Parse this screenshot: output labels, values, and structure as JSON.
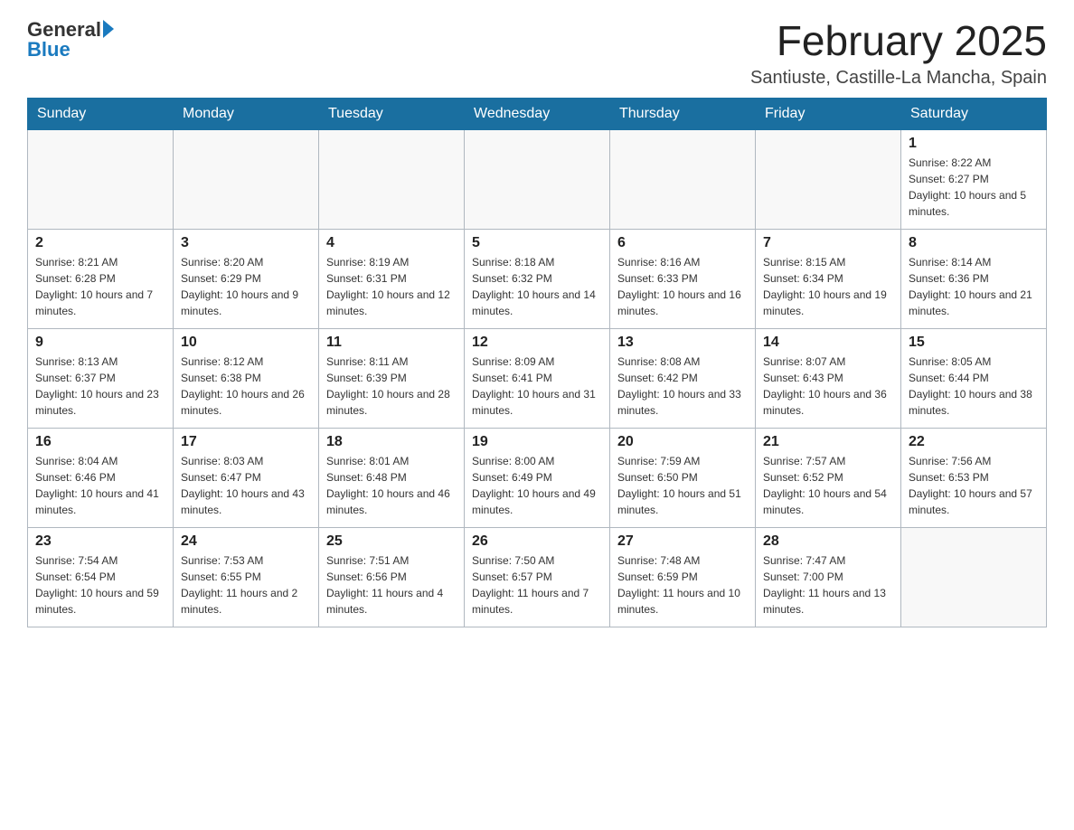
{
  "header": {
    "logo_general": "General",
    "logo_blue": "Blue",
    "month_title": "February 2025",
    "location": "Santiuste, Castille-La Mancha, Spain"
  },
  "weekdays": [
    "Sunday",
    "Monday",
    "Tuesday",
    "Wednesday",
    "Thursday",
    "Friday",
    "Saturday"
  ],
  "weeks": [
    [
      {
        "day": "",
        "info": ""
      },
      {
        "day": "",
        "info": ""
      },
      {
        "day": "",
        "info": ""
      },
      {
        "day": "",
        "info": ""
      },
      {
        "day": "",
        "info": ""
      },
      {
        "day": "",
        "info": ""
      },
      {
        "day": "1",
        "info": "Sunrise: 8:22 AM\nSunset: 6:27 PM\nDaylight: 10 hours and 5 minutes."
      }
    ],
    [
      {
        "day": "2",
        "info": "Sunrise: 8:21 AM\nSunset: 6:28 PM\nDaylight: 10 hours and 7 minutes."
      },
      {
        "day": "3",
        "info": "Sunrise: 8:20 AM\nSunset: 6:29 PM\nDaylight: 10 hours and 9 minutes."
      },
      {
        "day": "4",
        "info": "Sunrise: 8:19 AM\nSunset: 6:31 PM\nDaylight: 10 hours and 12 minutes."
      },
      {
        "day": "5",
        "info": "Sunrise: 8:18 AM\nSunset: 6:32 PM\nDaylight: 10 hours and 14 minutes."
      },
      {
        "day": "6",
        "info": "Sunrise: 8:16 AM\nSunset: 6:33 PM\nDaylight: 10 hours and 16 minutes."
      },
      {
        "day": "7",
        "info": "Sunrise: 8:15 AM\nSunset: 6:34 PM\nDaylight: 10 hours and 19 minutes."
      },
      {
        "day": "8",
        "info": "Sunrise: 8:14 AM\nSunset: 6:36 PM\nDaylight: 10 hours and 21 minutes."
      }
    ],
    [
      {
        "day": "9",
        "info": "Sunrise: 8:13 AM\nSunset: 6:37 PM\nDaylight: 10 hours and 23 minutes."
      },
      {
        "day": "10",
        "info": "Sunrise: 8:12 AM\nSunset: 6:38 PM\nDaylight: 10 hours and 26 minutes."
      },
      {
        "day": "11",
        "info": "Sunrise: 8:11 AM\nSunset: 6:39 PM\nDaylight: 10 hours and 28 minutes."
      },
      {
        "day": "12",
        "info": "Sunrise: 8:09 AM\nSunset: 6:41 PM\nDaylight: 10 hours and 31 minutes."
      },
      {
        "day": "13",
        "info": "Sunrise: 8:08 AM\nSunset: 6:42 PM\nDaylight: 10 hours and 33 minutes."
      },
      {
        "day": "14",
        "info": "Sunrise: 8:07 AM\nSunset: 6:43 PM\nDaylight: 10 hours and 36 minutes."
      },
      {
        "day": "15",
        "info": "Sunrise: 8:05 AM\nSunset: 6:44 PM\nDaylight: 10 hours and 38 minutes."
      }
    ],
    [
      {
        "day": "16",
        "info": "Sunrise: 8:04 AM\nSunset: 6:46 PM\nDaylight: 10 hours and 41 minutes."
      },
      {
        "day": "17",
        "info": "Sunrise: 8:03 AM\nSunset: 6:47 PM\nDaylight: 10 hours and 43 minutes."
      },
      {
        "day": "18",
        "info": "Sunrise: 8:01 AM\nSunset: 6:48 PM\nDaylight: 10 hours and 46 minutes."
      },
      {
        "day": "19",
        "info": "Sunrise: 8:00 AM\nSunset: 6:49 PM\nDaylight: 10 hours and 49 minutes."
      },
      {
        "day": "20",
        "info": "Sunrise: 7:59 AM\nSunset: 6:50 PM\nDaylight: 10 hours and 51 minutes."
      },
      {
        "day": "21",
        "info": "Sunrise: 7:57 AM\nSunset: 6:52 PM\nDaylight: 10 hours and 54 minutes."
      },
      {
        "day": "22",
        "info": "Sunrise: 7:56 AM\nSunset: 6:53 PM\nDaylight: 10 hours and 57 minutes."
      }
    ],
    [
      {
        "day": "23",
        "info": "Sunrise: 7:54 AM\nSunset: 6:54 PM\nDaylight: 10 hours and 59 minutes."
      },
      {
        "day": "24",
        "info": "Sunrise: 7:53 AM\nSunset: 6:55 PM\nDaylight: 11 hours and 2 minutes."
      },
      {
        "day": "25",
        "info": "Sunrise: 7:51 AM\nSunset: 6:56 PM\nDaylight: 11 hours and 4 minutes."
      },
      {
        "day": "26",
        "info": "Sunrise: 7:50 AM\nSunset: 6:57 PM\nDaylight: 11 hours and 7 minutes."
      },
      {
        "day": "27",
        "info": "Sunrise: 7:48 AM\nSunset: 6:59 PM\nDaylight: 11 hours and 10 minutes."
      },
      {
        "day": "28",
        "info": "Sunrise: 7:47 AM\nSunset: 7:00 PM\nDaylight: 11 hours and 13 minutes."
      },
      {
        "day": "",
        "info": ""
      }
    ]
  ]
}
